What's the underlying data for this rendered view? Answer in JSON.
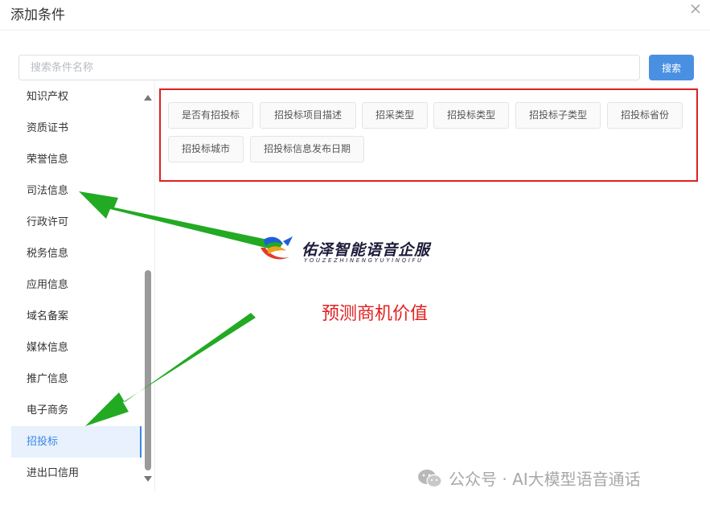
{
  "dialog": {
    "title": "添加条件"
  },
  "search": {
    "placeholder": "搜索条件名称",
    "value": "",
    "button_label": "搜索"
  },
  "sidebar": {
    "items": [
      {
        "label": "知识产权"
      },
      {
        "label": "资质证书"
      },
      {
        "label": "荣誉信息"
      },
      {
        "label": "司法信息"
      },
      {
        "label": "行政许可"
      },
      {
        "label": "税务信息"
      },
      {
        "label": "应用信息"
      },
      {
        "label": "域名备案"
      },
      {
        "label": "媒体信息"
      },
      {
        "label": "推广信息"
      },
      {
        "label": "电子商务"
      },
      {
        "label": "招投标",
        "active": true
      },
      {
        "label": "进出口信用"
      }
    ]
  },
  "tags": [
    {
      "label": "是否有招投标"
    },
    {
      "label": "招投标项目描述"
    },
    {
      "label": "招采类型"
    },
    {
      "label": "招投标类型"
    },
    {
      "label": "招投标子类型"
    },
    {
      "label": "招投标省份"
    },
    {
      "label": "招投标城市"
    },
    {
      "label": "招投标信息发布日期"
    }
  ],
  "overlay": {
    "brand_title": "佑泽智能语音企服",
    "brand_subtitle": "YOUZEZHINENGYUYINQIFU",
    "annotation": "预测商机价值",
    "watermark": "公众号 · AI大模型语音通话"
  },
  "colors": {
    "accent": "#3a86e8",
    "search_button": "#4a90e2",
    "highlight_border": "#e02020",
    "arrow": "#22aa22",
    "active_item_bg": "#e8f1fd"
  },
  "icons": [
    "close-icon",
    "wechat-icon",
    "brand-logo",
    "scroll-up-arrow",
    "scroll-down-arrow"
  ]
}
